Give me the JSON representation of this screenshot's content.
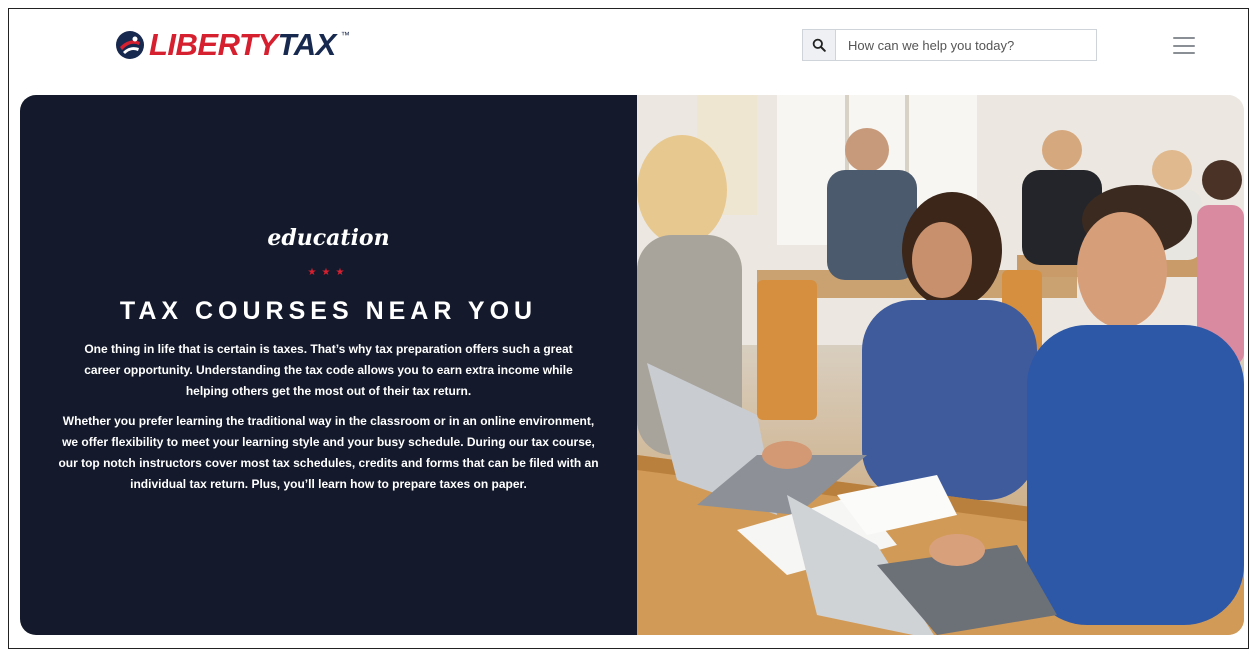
{
  "header": {
    "logo_word_red": "LIBERTY",
    "logo_word_navy": "TAX",
    "logo_tm": "™",
    "search": {
      "placeholder": "How can we help you today?",
      "icon": "search-icon"
    },
    "menu_icon": "hamburger-icon"
  },
  "hero": {
    "eyebrow": "education",
    "stars": "★★★",
    "headline": "TAX COURSES NEAR YOU",
    "paragraph1": "One thing in life that is certain is taxes. That’s why tax preparation offers such a great career opportunity. Understanding the tax code allows you to earn extra income while helping others get the most out of their tax return.",
    "paragraph2": "Whether you prefer learning the traditional way in the classroom or in an online environment, we offer flexibility to meet your learning style and your busy schedule. During our tax course, our top notch instructors cover most tax schedules, credits and forms that can be filed with an individual tax return. Plus, you’ll learn how to prepare taxes on paper."
  },
  "colors": {
    "brand_red": "#d6202f",
    "brand_navy": "#18294f",
    "hero_bg": "#141a2c"
  }
}
